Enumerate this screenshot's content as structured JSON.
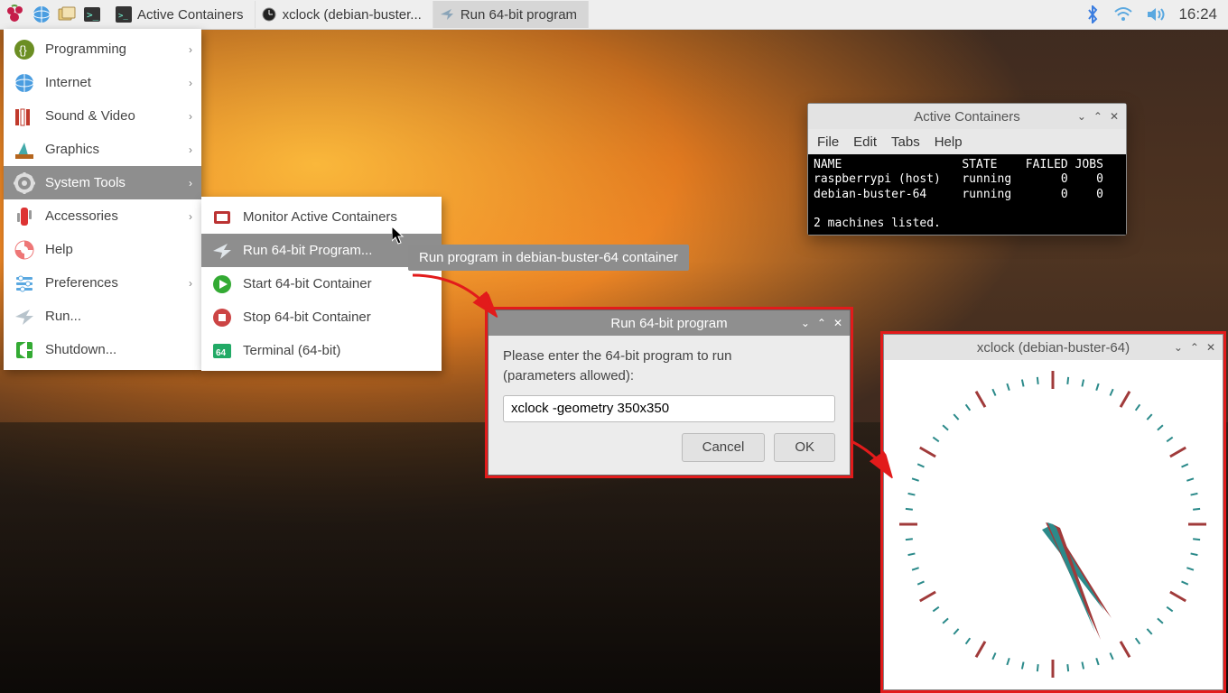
{
  "taskbar": {
    "tasks": [
      {
        "label": "Active Containers",
        "icon": "terminal"
      },
      {
        "label": "xclock (debian-buster...",
        "icon": "gear"
      },
      {
        "label": "Run 64-bit program",
        "icon": "plane",
        "active": true
      }
    ],
    "clock": "16:24"
  },
  "mainmenu": [
    {
      "label": "Programming",
      "sub": true
    },
    {
      "label": "Internet",
      "sub": true
    },
    {
      "label": "Sound & Video",
      "sub": true
    },
    {
      "label": "Graphics",
      "sub": true
    },
    {
      "label": "System Tools",
      "sub": true,
      "hov": true
    },
    {
      "label": "Accessories",
      "sub": true
    },
    {
      "label": "Help"
    },
    {
      "label": "Preferences",
      "sub": true
    },
    {
      "label": "Run..."
    },
    {
      "label": "Shutdown..."
    }
  ],
  "submenu": [
    {
      "label": "Monitor Active Containers"
    },
    {
      "label": "Run 64-bit Program...",
      "hov": true
    },
    {
      "label": "Start 64-bit Container"
    },
    {
      "label": "Stop 64-bit Container"
    },
    {
      "label": "Terminal (64-bit)"
    }
  ],
  "tooltip": "Run program in debian-buster-64 container",
  "terminal": {
    "title": "Active Containers",
    "menus": [
      "File",
      "Edit",
      "Tabs",
      "Help"
    ],
    "text": "NAME                 STATE    FAILED JOBS\nraspberrypi (host)   running       0    0\ndebian-buster-64     running       0    0\n\n2 machines listed."
  },
  "dialog": {
    "title": "Run 64-bit program",
    "prompt1": "Please enter the 64-bit program to run",
    "prompt2": "(parameters allowed):",
    "value": "xclock -geometry 350x350",
    "cancel": "Cancel",
    "ok": "OK"
  },
  "xclock": {
    "title": "xclock (debian-buster-64)"
  }
}
